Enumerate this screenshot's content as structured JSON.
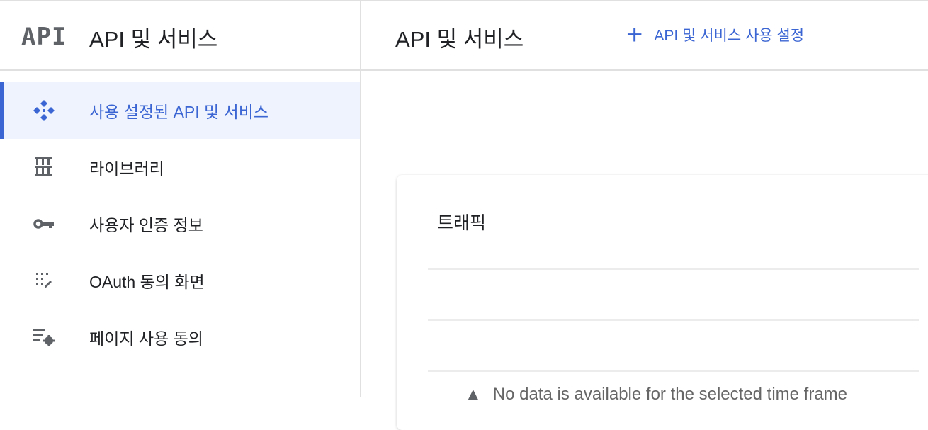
{
  "sidebar": {
    "logo": "API",
    "title": "API 및 서비스",
    "items": [
      {
        "label": "사용 설정된 API 및 서비스",
        "icon": "api-diamond-icon",
        "active": true
      },
      {
        "label": "라이브러리",
        "icon": "library-icon"
      },
      {
        "label": "사용자 인증 정보",
        "icon": "key-icon"
      },
      {
        "label": "OAuth 동의 화면",
        "icon": "oauth-consent-icon"
      },
      {
        "label": "페이지 사용 동의",
        "icon": "page-settings-icon"
      }
    ]
  },
  "header": {
    "title": "API 및 서비스",
    "enable_button": "API 및 서비스 사용 설정"
  },
  "card": {
    "title": "트래픽",
    "no_data": "No data is available for the selected time frame"
  },
  "colors": {
    "accent": "#3b65d3",
    "active_bg": "#eef3fd"
  }
}
